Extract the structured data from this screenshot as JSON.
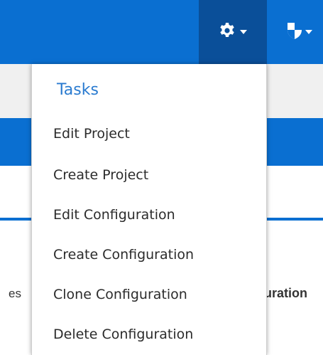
{
  "toolbar": {
    "settings_icon": "gear-icon",
    "security_icon": "shield-icon"
  },
  "table": {
    "columns": [
      {
        "label": "es"
      },
      {
        "label": "uration"
      }
    ]
  },
  "dropdown": {
    "header": "Tasks",
    "items": [
      {
        "label": "Edit Project"
      },
      {
        "label": "Create Project"
      },
      {
        "label": "Edit Configuration"
      },
      {
        "label": "Create Configuration"
      },
      {
        "label": "Clone Configuration"
      },
      {
        "label": "Delete Configuration"
      }
    ]
  },
  "colors": {
    "primary": "#0a6fd1",
    "primary_dark": "#0a4f99",
    "header_text": "#2a7bd0",
    "subbar": "#f0f0f0"
  }
}
